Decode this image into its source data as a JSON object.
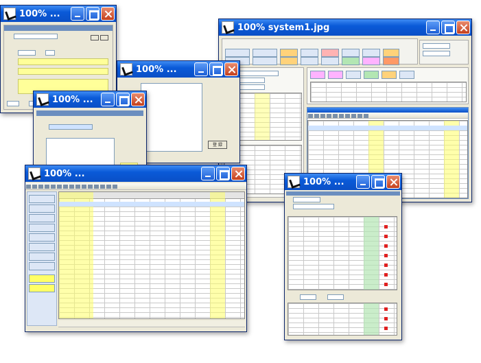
{
  "windows": {
    "back_right": {
      "title": "100% system1.jpg"
    },
    "dialog_1": {
      "title": "100% ...",
      "ok_label": "登 録"
    },
    "dialog_2": {
      "title": "100% ...",
      "ok_label": "登 録"
    },
    "dialog_3": {
      "title": "100% ..."
    },
    "sheet_window": {
      "title": "100% ..."
    },
    "front_form": {
      "title": "100% ..."
    }
  }
}
